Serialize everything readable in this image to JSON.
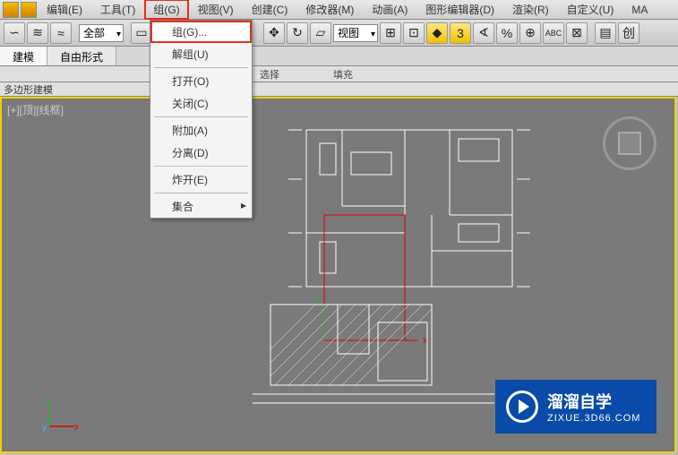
{
  "menubar": {
    "items": [
      "编辑(E)",
      "工具(T)",
      "组(G)",
      "视图(V)",
      "创建(C)",
      "修改器(M)",
      "动画(A)",
      "图形编辑器(D)",
      "渲染(R)",
      "自定义(U)",
      "MA"
    ]
  },
  "toolbar": {
    "filter_combo": "全部",
    "view_combo": "视图",
    "snap_label": "3"
  },
  "tabs": {
    "items": [
      "建模",
      "自由形式"
    ],
    "active": 0
  },
  "labels": {
    "items": [
      "选择",
      "填充"
    ]
  },
  "subrow": "多边形建模",
  "viewport": {
    "label": "[+][顶][线框]",
    "axis_x": "x",
    "axis_y": "y",
    "axis_z": "z",
    "plan_x": "x",
    "plan_y": "y"
  },
  "dropdown": {
    "items": [
      {
        "label": "组(G)...",
        "highlighted": true
      },
      {
        "label": "解组(U)"
      },
      {
        "sep": true
      },
      {
        "label": "打开(O)"
      },
      {
        "label": "关闭(C)"
      },
      {
        "sep": true
      },
      {
        "label": "附加(A)"
      },
      {
        "label": "分离(D)"
      },
      {
        "sep": true
      },
      {
        "label": "炸开(E)"
      },
      {
        "sep": true
      },
      {
        "label": "集合",
        "has_sub": true
      }
    ]
  },
  "watermark": {
    "title": "溜溜自学",
    "url": "ZIXUE.3D66.COM"
  }
}
